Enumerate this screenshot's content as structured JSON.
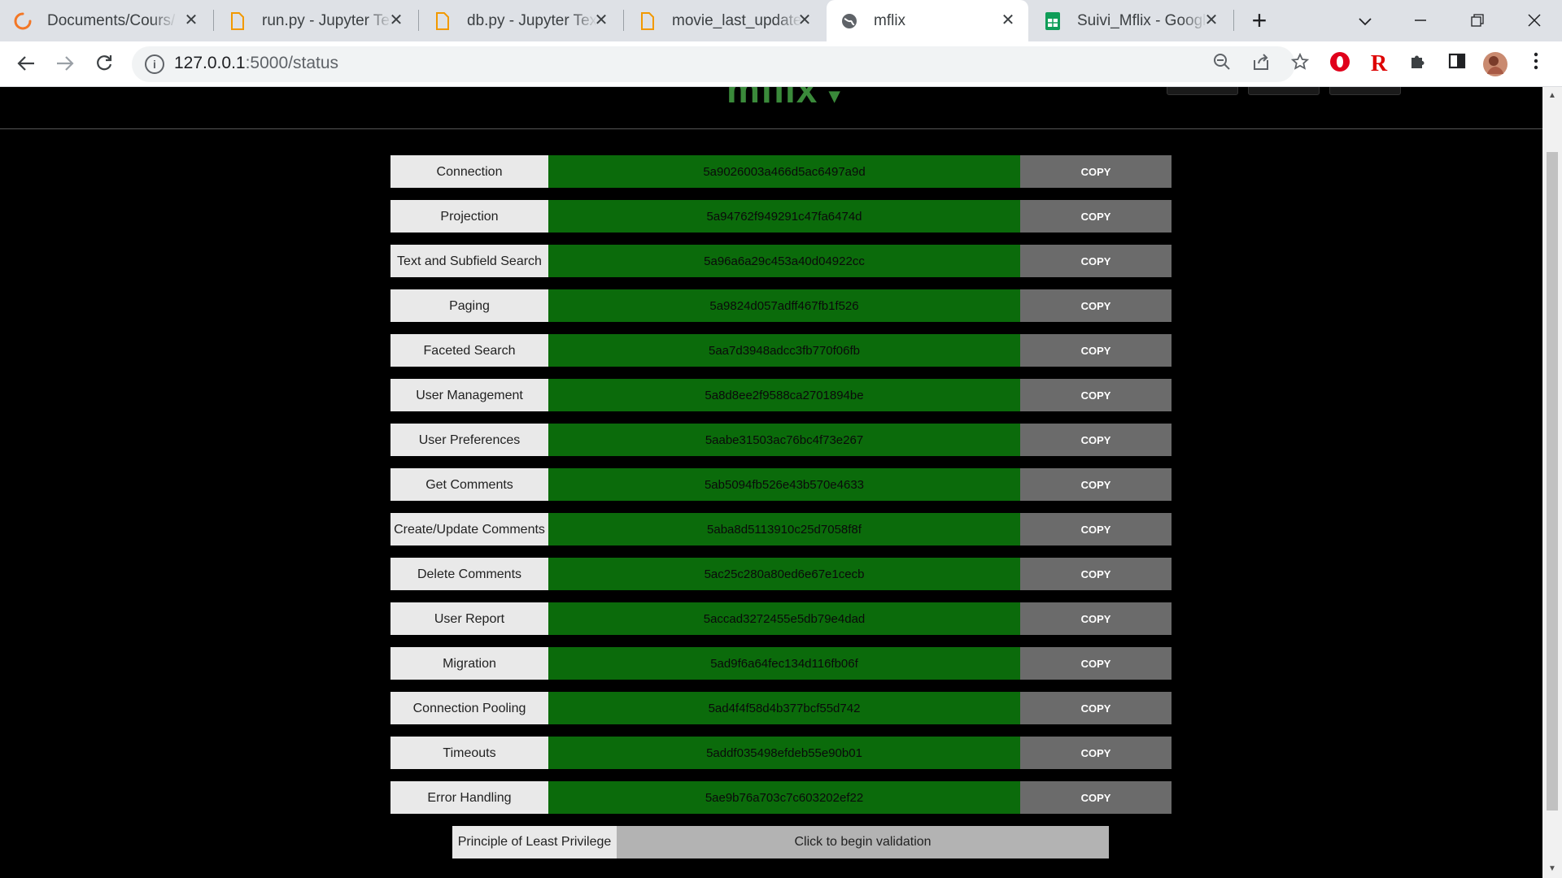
{
  "browser": {
    "tabs": [
      {
        "title": "Documents/Cours/",
        "icon": "jupyter-loading-icon",
        "active": false
      },
      {
        "title": "run.py - Jupyter Tex",
        "icon": "file-icon",
        "active": false
      },
      {
        "title": "db.py - Jupyter Text",
        "icon": "file-icon",
        "active": false
      },
      {
        "title": "movie_last_updated",
        "icon": "file-icon",
        "active": false
      },
      {
        "title": "mflix",
        "icon": "globe-icon",
        "active": true
      },
      {
        "title": "Suivi_Mflix - Google",
        "icon": "sheets-icon",
        "active": false
      }
    ],
    "new_tab": "+",
    "url_host": "127.0.0.1",
    "url_path": ":5000/status"
  },
  "app": {
    "logo": "mflix"
  },
  "tickets": [
    {
      "label": "Connection",
      "hash": "5a9026003a466d5ac6497a9d",
      "button": "COPY"
    },
    {
      "label": "Projection",
      "hash": "5a94762f949291c47fa6474d",
      "button": "COPY"
    },
    {
      "label": "Text and Subfield Search",
      "hash": "5a96a6a29c453a40d04922cc",
      "button": "COPY"
    },
    {
      "label": "Paging",
      "hash": "5a9824d057adff467fb1f526",
      "button": "COPY"
    },
    {
      "label": "Faceted Search",
      "hash": "5aa7d3948adcc3fb770f06fb",
      "button": "COPY"
    },
    {
      "label": "User Management",
      "hash": "5a8d8ee2f9588ca2701894be",
      "button": "COPY"
    },
    {
      "label": "User Preferences",
      "hash": "5aabe31503ac76bc4f73e267",
      "button": "COPY"
    },
    {
      "label": "Get Comments",
      "hash": "5ab5094fb526e43b570e4633",
      "button": "COPY"
    },
    {
      "label": "Create/Update Comments",
      "hash": "5aba8d5113910c25d7058f8f",
      "button": "COPY"
    },
    {
      "label": "Delete Comments",
      "hash": "5ac25c280a80ed6e67e1cecb",
      "button": "COPY"
    },
    {
      "label": "User Report",
      "hash": "5accad3272455e5db79e4dad",
      "button": "COPY"
    },
    {
      "label": "Migration",
      "hash": "5ad9f6a64fec134d116fb06f",
      "button": "COPY"
    },
    {
      "label": "Connection Pooling",
      "hash": "5ad4f4f58d4b377bcf55d742",
      "button": "COPY"
    },
    {
      "label": "Timeouts",
      "hash": "5addf035498efdeb55e90b01",
      "button": "COPY"
    },
    {
      "label": "Error Handling",
      "hash": "5ae9b76a703c7c603202ef22",
      "button": "COPY"
    }
  ],
  "least_privilege": {
    "label": "Principle of Least Privilege",
    "button": "Click to begin validation"
  }
}
